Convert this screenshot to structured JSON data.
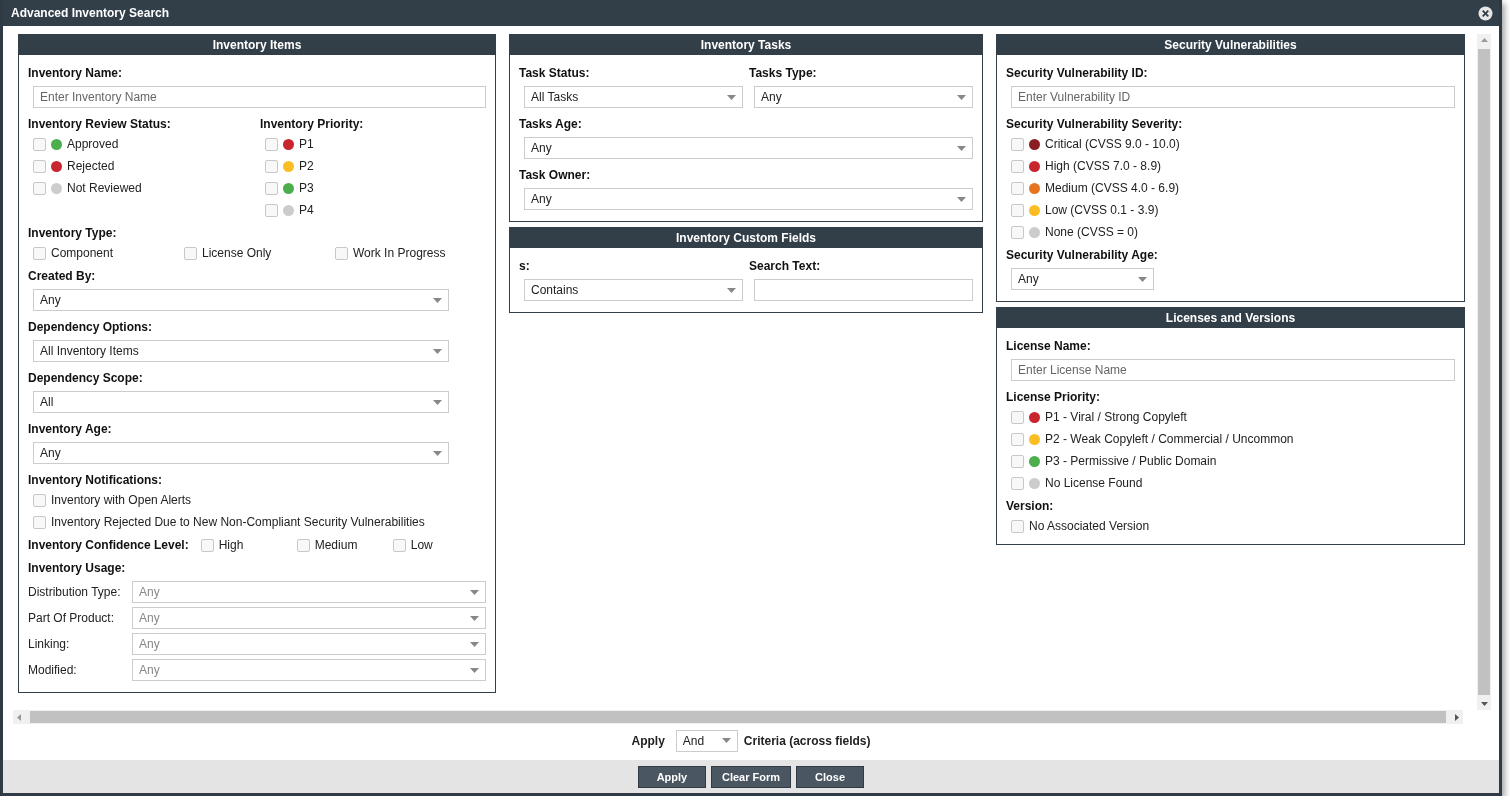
{
  "window": {
    "title": "Advanced Inventory Search"
  },
  "columns": [
    [
      {
        "title": "Inventory Items",
        "fields": [
          {
            "kind": "input",
            "label": "Inventory Name:",
            "placeholder": "Enter Inventory Name"
          },
          {
            "kind": "pair",
            "items": [
              {
                "kind": "checklist",
                "label": "Inventory Review Status:",
                "options": [
                  {
                    "label": "Approved",
                    "checked": false,
                    "color": "#4cae4c"
                  },
                  {
                    "label": "Rejected",
                    "checked": false,
                    "color": "#c9252c"
                  },
                  {
                    "label": "Not Reviewed",
                    "checked": false,
                    "color": "#cccccc"
                  }
                ]
              },
              {
                "kind": "checklist",
                "label": "Inventory Priority:",
                "options": [
                  {
                    "label": "P1",
                    "checked": false,
                    "color": "#c9252c"
                  },
                  {
                    "label": "P2",
                    "checked": false,
                    "color": "#fbbd24"
                  },
                  {
                    "label": "P3",
                    "checked": false,
                    "color": "#4cae4c"
                  },
                  {
                    "label": "P4",
                    "checked": false,
                    "color": "#cccccc"
                  }
                ]
              }
            ]
          },
          {
            "kind": "check_row",
            "label": "Inventory Type:",
            "options": [
              {
                "label": "Component",
                "checked": false
              },
              {
                "label": "License Only",
                "checked": false
              },
              {
                "label": "Work In Progress",
                "checked": false
              }
            ]
          },
          {
            "kind": "select",
            "label": "Created By:",
            "value": "Any"
          },
          {
            "kind": "select",
            "label": "Dependency Options:",
            "value": "All Inventory Items"
          },
          {
            "kind": "select",
            "label": "Dependency Scope:",
            "value": "All"
          },
          {
            "kind": "select",
            "label": "Inventory Age:",
            "value": "Any"
          },
          {
            "kind": "checklist",
            "label": "Inventory Notifications:",
            "options": [
              {
                "label": "Inventory with Open Alerts",
                "checked": false
              },
              {
                "label": "Inventory Rejected Due to New Non-Compliant Security Vulnerabilities",
                "checked": false
              }
            ]
          },
          {
            "kind": "inline_checks",
            "label": "Inventory Confidence Level:",
            "options": [
              {
                "label": "High",
                "checked": false
              },
              {
                "label": "Medium",
                "checked": false
              },
              {
                "label": "Low",
                "checked": false
              }
            ]
          },
          {
            "kind": "usage",
            "label": "Inventory Usage:",
            "rows": [
              {
                "label": "Distribution Type:",
                "value": "Any",
                "disabled": true
              },
              {
                "label": "Part Of Product:",
                "value": "Any",
                "disabled": true
              },
              {
                "label": "Linking:",
                "value": "Any",
                "disabled": true
              },
              {
                "label": "Modified:",
                "value": "Any",
                "disabled": true
              }
            ]
          }
        ]
      }
    ],
    [
      {
        "title": "Inventory Tasks",
        "fields": [
          {
            "kind": "pair",
            "items": [
              {
                "kind": "select",
                "label": "Task Status:",
                "value": "All Tasks"
              },
              {
                "kind": "select",
                "label": "Tasks Type:",
                "value": "Any"
              }
            ]
          },
          {
            "kind": "select",
            "label": "Tasks Age:",
            "value": "Any"
          },
          {
            "kind": "select",
            "label": "Task Owner:",
            "value": "Any"
          }
        ]
      },
      {
        "title": "Inventory Custom Fields",
        "fields": [
          {
            "kind": "pair",
            "items": [
              {
                "kind": "select",
                "label": "s:",
                "value": "Contains"
              },
              {
                "kind": "input",
                "label": "Search Text:"
              }
            ]
          }
        ]
      }
    ],
    [
      {
        "title": "Security Vulnerabilities",
        "fields": [
          {
            "kind": "input",
            "label": "Security Vulnerability ID:",
            "placeholder": "Enter Vulnerability ID"
          },
          {
            "kind": "checklist",
            "label": "Security Vulnerability Severity:",
            "options": [
              {
                "label": "Critical (CVSS 9.0 - 10.0)",
                "checked": false,
                "color": "#8b1e22"
              },
              {
                "label": "High (CVSS 7.0 - 8.9)",
                "checked": false,
                "color": "#c9252c"
              },
              {
                "label": "Medium (CVSS 4.0 - 6.9)",
                "checked": false,
                "color": "#e5761f"
              },
              {
                "label": "Low (CVSS 0.1 - 3.9)",
                "checked": false,
                "color": "#fbbd24"
              },
              {
                "label": "None (CVSS = 0)",
                "checked": false,
                "color": "#cccccc"
              }
            ]
          },
          {
            "kind": "short_select",
            "label": "Security Vulnerability Age:",
            "value": "Any"
          }
        ]
      },
      {
        "title": "Licenses and Versions",
        "fields": [
          {
            "kind": "input",
            "label": "License Name:",
            "placeholder": "Enter License Name"
          },
          {
            "kind": "checklist",
            "label": "License Priority:",
            "options": [
              {
                "label": "P1 - Viral / Strong Copyleft",
                "checked": false,
                "color": "#c9252c"
              },
              {
                "label": "P2 - Weak Copyleft / Commercial / Uncommon",
                "checked": false,
                "color": "#fbbd24"
              },
              {
                "label": "P3 - Permissive / Public Domain",
                "checked": false,
                "color": "#4cae4c"
              },
              {
                "label": "No License Found",
                "checked": false,
                "color": "#cccccc"
              }
            ]
          },
          {
            "kind": "checklist",
            "label": "Version:",
            "options": [
              {
                "label": "No Associated Version",
                "checked": false
              }
            ]
          }
        ]
      }
    ]
  ],
  "criteria": {
    "before": "Apply",
    "value": "And",
    "after": "Criteria (across fields)"
  },
  "buttons": [
    "Apply",
    "Clear Form",
    "Close"
  ]
}
